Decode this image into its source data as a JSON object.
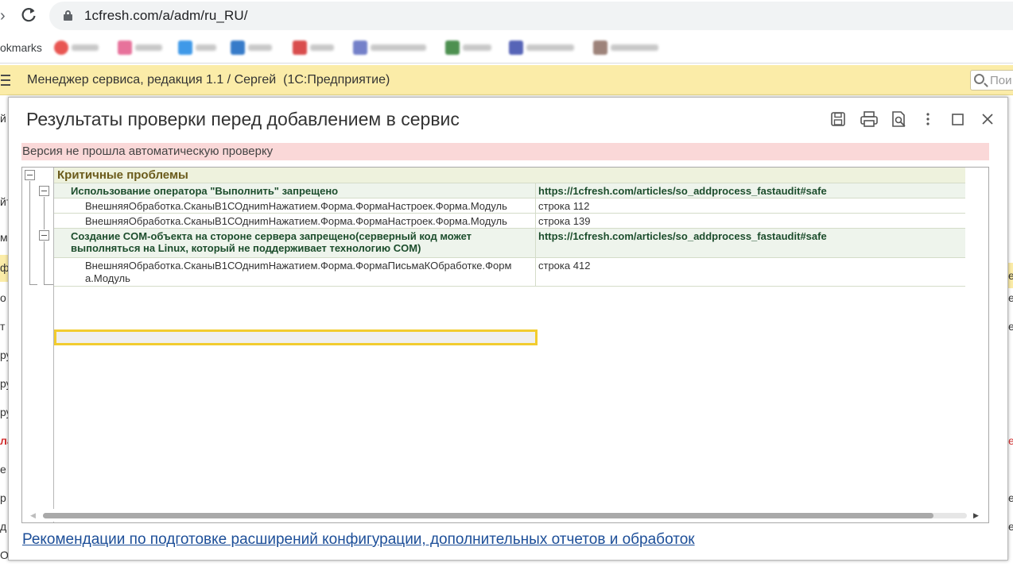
{
  "browser": {
    "url": "1cfresh.com/a/adm/ru_RU/",
    "bookmarks_label": "okmarks",
    "bookmark_colors": [
      "#e53935",
      "#e35a8a",
      "#1e88e5",
      "#1565c0",
      "#d32f2f",
      "#5c6bc0",
      "#2e7d32",
      "#3949ab",
      "#8d6e63"
    ]
  },
  "app": {
    "title": "Менеджер сервиса, редакция 1.1 / Сергей  (1С:Предприятие)",
    "search_placeholder": "Пои"
  },
  "background": {
    "left_fragments": [
      "й",
      "йт",
      "м",
      "ф",
      "о",
      "т",
      "ру",
      "ру",
      "ру",
      "ла",
      "е",
      "р",
      "д",
      "ОТ"
    ],
    "right_fragments": [
      "ер",
      "е",
      "е",
      "е",
      "е",
      "е"
    ]
  },
  "modal": {
    "title": "Результаты проверки перед добавлением в сервис",
    "toolbar": {
      "save_icon": "save-icon",
      "print_icon": "print-icon",
      "preview_icon": "print-preview-icon",
      "more_icon": "more-icon",
      "maximize_icon": "maximize-icon",
      "close_icon": "close-icon"
    },
    "warning": "Версия не прошла автоматическую проверку",
    "tree": {
      "critical_header": "Критичные проблемы",
      "groups": [
        {
          "title": "Использование оператора \"Выполнить\" запрещено",
          "link": "https://1cfresh.com/articles/so_addprocess_fastaudit#safe",
          "items": [
            {
              "module": "ВнешняяОбработка.СканыВ1СОдниmНажатием.Форма.ФормаНастроек.Форма.Модуль",
              "line": "строка 112"
            },
            {
              "module": "ВнешняяОбработка.СканыВ1СОдниmНажатием.Форма.ФормаНастроек.Форма.Модуль",
              "line": "строка 139"
            }
          ]
        },
        {
          "title_line1": "Создание COM-объекта на стороне сервера запрещено(серверный код может",
          "title_line2": "выполняться на Linux, который не поддерживает технологию COM)",
          "link": "https://1cfresh.com/articles/so_addprocess_fastaudit#safe",
          "items": [
            {
              "module_line1": "ВнешняяОбработка.СканыВ1СОдниmНажатием.Форма.ФормаПисьмаКОбработке.Форм",
              "module_line2": "а.Модуль",
              "line": "строка 412"
            }
          ]
        }
      ]
    },
    "recommendations_link": "Рекомендации по подготовке расширений конфигурации, дополнительных отчетов и обработок"
  }
}
